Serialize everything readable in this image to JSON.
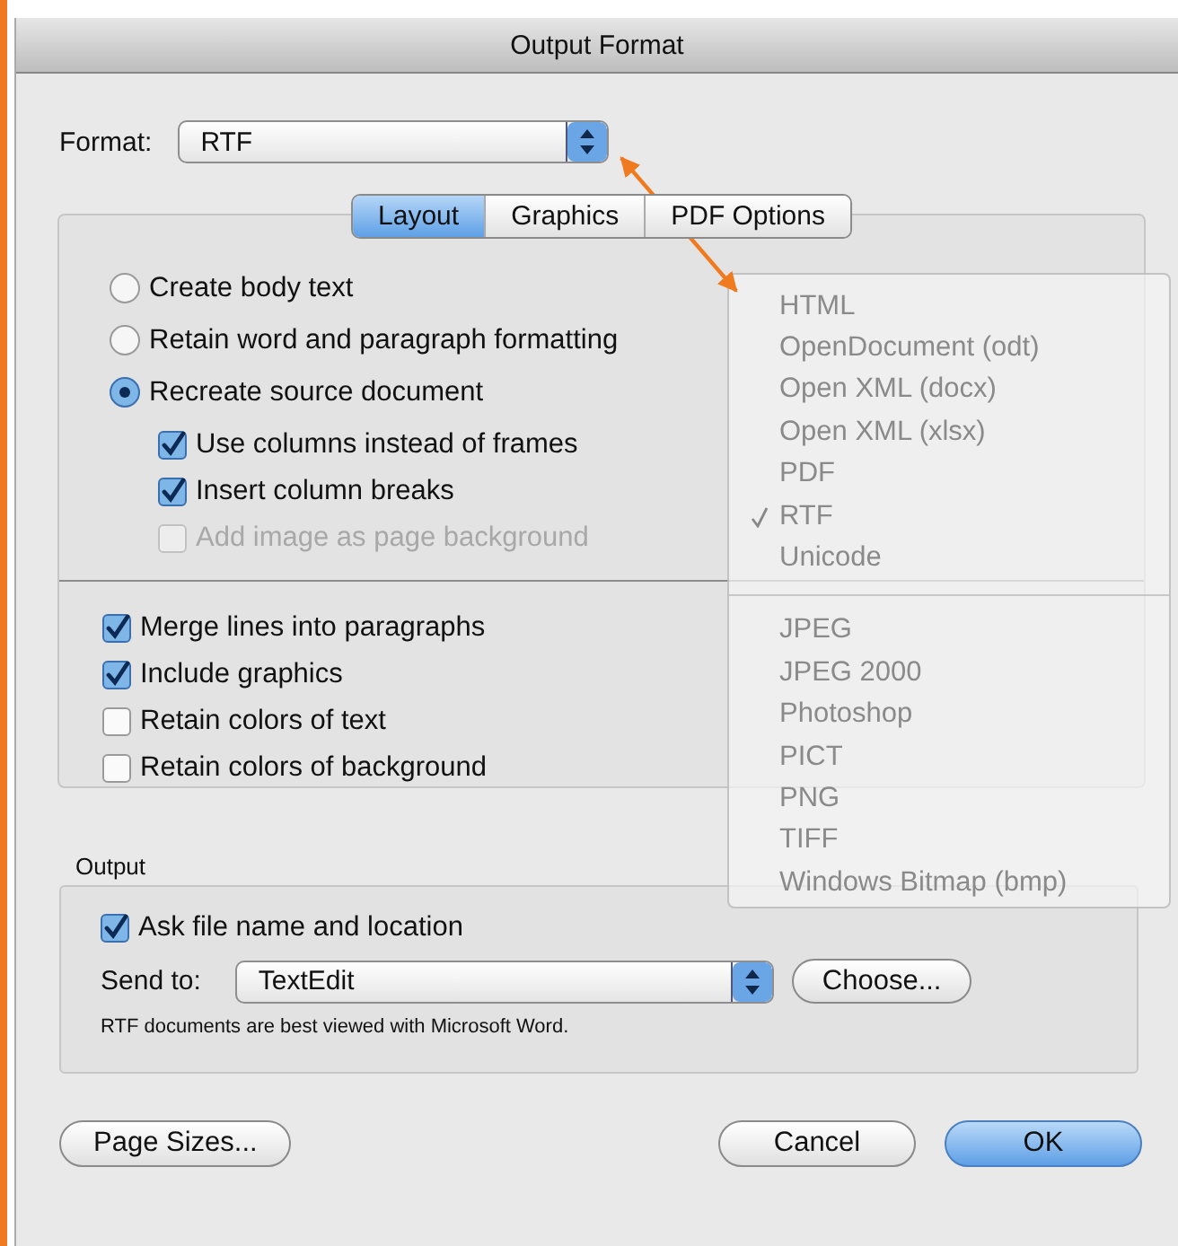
{
  "window": {
    "title": "Output Format"
  },
  "format": {
    "label": "Format:",
    "value": "RTF"
  },
  "tabs": [
    {
      "label": "Layout",
      "selected": true
    },
    {
      "label": "Graphics",
      "selected": false
    },
    {
      "label": "PDF Options",
      "selected": false
    }
  ],
  "text_modes": [
    {
      "label": "Create body text",
      "selected": false
    },
    {
      "label": "Retain word and paragraph formatting",
      "selected": false
    },
    {
      "label": "Recreate source document",
      "selected": true
    }
  ],
  "source_options": [
    {
      "label": "Use columns instead of frames",
      "checked": true,
      "disabled": false
    },
    {
      "label": "Insert column breaks",
      "checked": true,
      "disabled": false
    },
    {
      "label": "Add image as page background",
      "checked": false,
      "disabled": true
    }
  ],
  "options": [
    {
      "label": "Merge lines into paragraphs",
      "checked": true
    },
    {
      "label": "Include graphics",
      "checked": true
    },
    {
      "label": "Retain colors of text",
      "checked": false
    },
    {
      "label": "Retain colors of background",
      "checked": false
    }
  ],
  "output": {
    "heading": "Output",
    "ask_file": {
      "label": "Ask file name and location",
      "checked": true
    },
    "send_to": {
      "label": "Send to:",
      "value": "TextEdit"
    },
    "choose_button": "Choose...",
    "note": "RTF documents are best viewed with Microsoft Word."
  },
  "footer_left": [
    {
      "label": "Page Sizes...",
      "kind": "plain"
    }
  ],
  "footer_right": [
    {
      "label": "Cancel",
      "kind": "plain"
    },
    {
      "label": "OK",
      "kind": "default"
    }
  ],
  "format_menu": [
    [
      {
        "label": "HTML",
        "checked": false
      },
      {
        "label": "OpenDocument (odt)",
        "checked": false
      },
      {
        "label": "Open XML (docx)",
        "checked": false
      },
      {
        "label": "Open XML (xlsx)",
        "checked": false
      },
      {
        "label": "PDF",
        "checked": false
      },
      {
        "label": "RTF",
        "checked": true
      },
      {
        "label": "Unicode",
        "checked": false
      }
    ],
    [
      {
        "label": "JPEG",
        "checked": false
      },
      {
        "label": "JPEG 2000",
        "checked": false
      },
      {
        "label": "Photoshop",
        "checked": false
      },
      {
        "label": "PICT",
        "checked": false
      },
      {
        "label": "PNG",
        "checked": false
      },
      {
        "label": "TIFF",
        "checked": false
      },
      {
        "label": "Windows Bitmap (bmp)",
        "checked": false
      }
    ]
  ]
}
